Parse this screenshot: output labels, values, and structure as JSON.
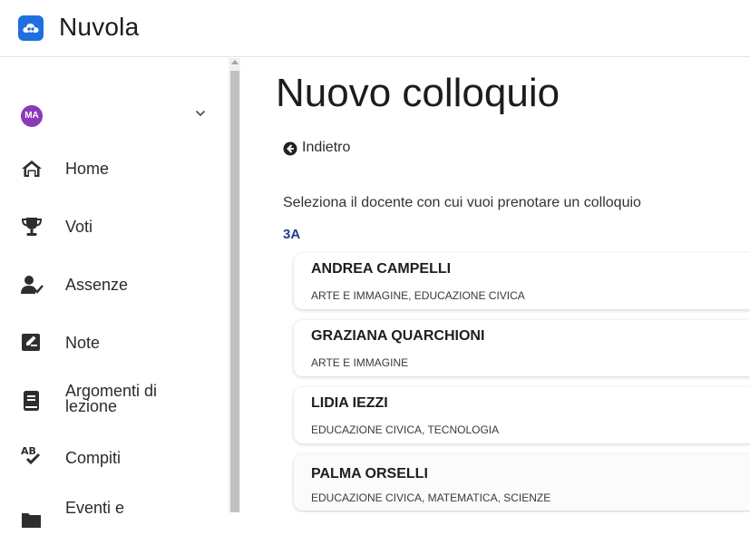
{
  "app": {
    "title": "Nuvola",
    "brand_color": "#1f6fe0"
  },
  "user": {
    "initials": "MA",
    "avatar_color": "#8a3ab9"
  },
  "sidebar": {
    "items": [
      {
        "label": "Home",
        "icon": "home-icon"
      },
      {
        "label": "Voti",
        "icon": "trophy-icon"
      },
      {
        "label": "Assenze",
        "icon": "user-check-icon"
      },
      {
        "label": "Note",
        "icon": "note-edit-icon"
      },
      {
        "label": "Argomenti di lezione",
        "icon": "book-icon"
      },
      {
        "label": "Compiti",
        "icon": "spellcheck-icon"
      },
      {
        "label": "Eventi e",
        "icon": "folder-icon"
      }
    ]
  },
  "main": {
    "title": "Nuovo colloquio",
    "back_label": "Indietro",
    "instructions": "Seleziona il docente con cui vuoi prenotare un colloquio",
    "class_label": "3A",
    "class_label_color": "#233b8f",
    "teachers": [
      {
        "name": "ANDREA CAMPELLI",
        "subjects": "ARTE E IMMAGINE, EDUCAZIONE CIVICA"
      },
      {
        "name": "GRAZIANA QUARCHIONI",
        "subjects": "ARTE E IMMAGINE"
      },
      {
        "name": "LIDIA IEZZI",
        "subjects": "EDUCAZIONE CIVICA, TECNOLOGIA"
      },
      {
        "name": "PALMA ORSELLI",
        "subjects": "EDUCAZIONE CIVICA, MATEMATICA, SCIENZE"
      }
    ]
  }
}
